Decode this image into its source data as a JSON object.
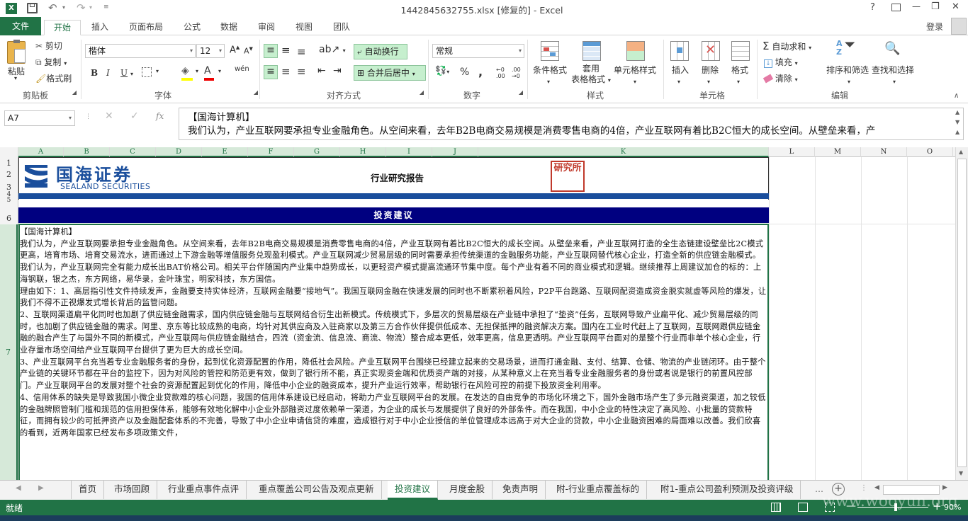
{
  "titlebar": {
    "title": "1442845632755.xlsx [修复的] - Excel",
    "help": "?",
    "min": "—",
    "restore": "❐",
    "close": "✕"
  },
  "tabs": {
    "file": "文件",
    "home": "开始",
    "insert": "插入",
    "layout": "页面布局",
    "formula": "公式",
    "data": "数据",
    "review": "审阅",
    "view": "视图",
    "team": "团队",
    "login": "登录"
  },
  "ribbon": {
    "paste": "粘贴",
    "cut": "剪切",
    "copy": "复制",
    "painter": "格式刷",
    "clipboard": "剪贴板",
    "font_name": "楷体",
    "font_size": "12",
    "bold": "B",
    "italic": "I",
    "underline": "U",
    "wen": "wén",
    "font_group": "字体",
    "wrap": "自动换行",
    "merge": "合并后居中",
    "align_group": "对齐方式",
    "numfmt": "常规",
    "percent": "%",
    "comma": ",",
    "number_group": "数字",
    "cond": "条件格式",
    "table1": "套用",
    "table2": "表格格式",
    "cellstyle": "单元格样式",
    "style_group": "样式",
    "insert": "插入",
    "delete": "删除",
    "format": "格式",
    "cells_group": "单元格",
    "autosum": "自动求和",
    "fill": "填充",
    "clear": "清除",
    "sort": "排序和筛选",
    "find": "查找和选择",
    "edit_group": "编辑"
  },
  "formula": {
    "namebox": "A7",
    "fx": "fx",
    "line1": "【国海计算机】",
    "line2": "我们认为，产业互联网要承担专业金融角色。从空间来看，去年B2B电商交易规模是消费零售电商的4倍，产业互联网有着比B2C恒大的成长空间。从壁垒来看，产"
  },
  "cols": [
    "A",
    "B",
    "C",
    "D",
    "E",
    "F",
    "G",
    "H",
    "I",
    "J",
    "K",
    "L",
    "M",
    "N",
    "O"
  ],
  "rows": [
    "1",
    "2",
    "3",
    "4",
    "5",
    "6",
    "7"
  ],
  "sheet": {
    "logo_cn": "国海证券",
    "logo_en": "SEALAND SECURITIES",
    "report_title": "行业研究报告",
    "seal_text": "研究所",
    "section": "投资建议",
    "lines": [
      "【国海计算机】",
      "我们认为，产业互联网要承担专业金融角色。从空间来看，去年B2B电商交易规模是消费零售电商的4倍，产业互联网有着比B2C恒大的成长空间。从壁垒来看，产业互联网打造的全生态链建设壁垒比2C模式更高，培育市场、培育交易流水，进而通过上下游金融等增值服务兑现盈利模式。产业互联网减少贸易层级的同时需要承担传统渠道的金融服务功能，产业互联网替代核心企业，打造全新的供应链金融模式。",
      "我们认为，产业互联网完全有能力成长出BAT价格公司。相关平台伴随国内产业集中趋势成长，以更轻资产模式提高流通环节集中度。每个产业有着不同的商业模式和逻辑。继续推荐上周建议加仓的标的：上海钢联，银之杰，东方网络，易华录，金叶珠宝，明家科技，东方国信。",
      "理由如下：1、高层指引性文件持续发声，金融要支持实体经济，互联网金融要“接地气”。我国互联网金融在快速发展的同时也不断累积着风险，P2P平台跑路、互联网配资造成资金脱实就虚等风险的爆发，让我们不得不正视爆发式增长背后的监管问题。",
      "2、互联网渠道扁平化同时也加剧了供应链金融需求，国内供应链金融与互联网结合衍生出新模式。传统模式下，多层次的贸易层级在产业链中承担了“垫资”任务，互联网导致产业扁平化、减少贸易层级的同时，也加剧了供应链金融的需求。阿里、京东等比较成熟的电商，均针对其供应商及入驻商家以及第三方合作伙伴提供低成本、无担保抵押的融资解决方案。国内在工业时代赶上了互联网，互联网跟供应链金融的融合产生了与国外不同的新模式，产业互联网与供应链金融结合，四流（资金流、信息流、商流、物流）整合成本更低，效率更高，信息更透明。产业互联网平台面对的是整个行业而非单个核心企业，行业存量市场空间给产业互联网平台提供了更为巨大的成长空间。",
      "3、产业互联网平台充当着专业金融服务者的身份，起到优化资源配置的作用，降低社会风险。产业互联网平台围绕已经建立起来的交易场景，进而打通金融、支付、结算、仓储、物流的产业链闭环。由于整个产业链的关键环节都在平台的监控下，因为对风险的管控和防范更有效，做到了银行所不能，真正实现资金端和优质资产端的对接，从某种意义上在充当着专业金融服务者的身份或者说是银行的前置风控部门。产业互联网平台的发展对整个社会的资源配置起到优化的作用，降低中小企业的融资成本，提升产业运行效率，帮助银行在风险可控的前提下投放资金利用率。",
      "4、信用体系的缺失是导致我国小微企业贷款难的核心问题，我国的信用体系建设已经启动，将助力产业互联网平台的发展。在发达的自由竞争的市场化环境之下，国外金融市场产生了多元融资渠道，加之较低的金融牌照管制门槛和规范的信用担保体系，能够有效地化解中小企业外部融资过度依赖单一渠道，为企业的成长与发展提供了良好的外部条件。而在我国，中小企业的特性决定了高风险、小批量的贷款特征，而拥有较少的可抵押资产以及金融配套体系的不完善，导致了中小企业申请信贷的难度，造成银行对于中小企业授信的单位管理成本远高于对大企业的贷款，中小企业融资困难的局面难以改善。我们欣喜的看到，近两年国家已经发布多项政策文件，"
    ]
  },
  "sheettabs": [
    "首页",
    "市场回顾",
    "行业重点事件点评",
    "重点覆盖公司公告及观点更新",
    "投资建议",
    "月度金股",
    "免责声明",
    "附-行业重点覆盖标的",
    "附1-重点公司盈利预测及投资评级"
  ],
  "status": {
    "ready": "就绪",
    "zoom": "90%",
    "watermark": "www.wooyun.org"
  },
  "colors": {
    "excel_green": "#217346",
    "navy": "#000080",
    "seal_red": "#c0392b"
  }
}
